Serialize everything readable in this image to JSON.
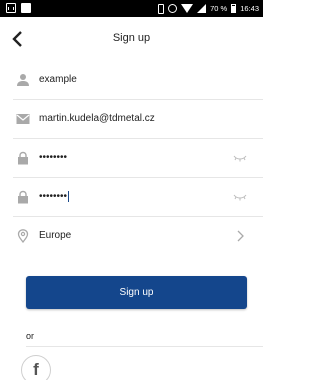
{
  "status_bar": {
    "battery_percent": "70 %",
    "time": "16:43"
  },
  "header": {
    "title": "Sign up"
  },
  "form": {
    "username": {
      "value": "example",
      "icon": "person-icon"
    },
    "email": {
      "value": "martin.kudela@tdmetal.cz",
      "icon": "mail-icon"
    },
    "password": {
      "value": "••••••••",
      "icon": "lock-icon",
      "toggle_icon": "eye-closed-icon"
    },
    "password_confirm": {
      "value": "••••••••",
      "icon": "lock-icon",
      "toggle_icon": "eye-closed-icon"
    },
    "region": {
      "value": "Europe",
      "icon": "location-pin-icon",
      "chevron_icon": "chevron-right-icon"
    }
  },
  "actions": {
    "signup_label": "Sign up",
    "or_label": "or",
    "facebook_icon": "facebook-icon"
  },
  "colors": {
    "primary": "#14468c",
    "icon_gray": "#a9a9a9",
    "separator": "#e6e6e6"
  }
}
